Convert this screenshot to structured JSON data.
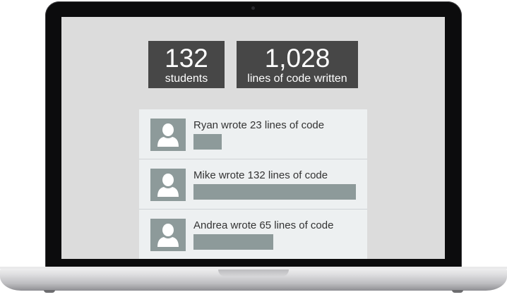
{
  "stats": {
    "students": {
      "number": "132",
      "label": "students"
    },
    "lines": {
      "number": "1,028",
      "label": "lines of code written"
    }
  },
  "activity": [
    {
      "text": "Ryan wrote 23 lines of code",
      "lines": 23,
      "avatar_icon": "user-silhouette-icon"
    },
    {
      "text": "Mike wrote 132 lines of code",
      "lines": 132,
      "avatar_icon": "user-silhouette-icon"
    },
    {
      "text": "Andrea wrote 65 lines of code",
      "lines": 65,
      "avatar_icon": "user-silhouette-icon"
    }
  ],
  "colors": {
    "stat_tile": "#474747",
    "screen_bg": "#dcdcdc",
    "feed_bg": "#edf0f1",
    "accent_gray": "#8d9a9a"
  }
}
